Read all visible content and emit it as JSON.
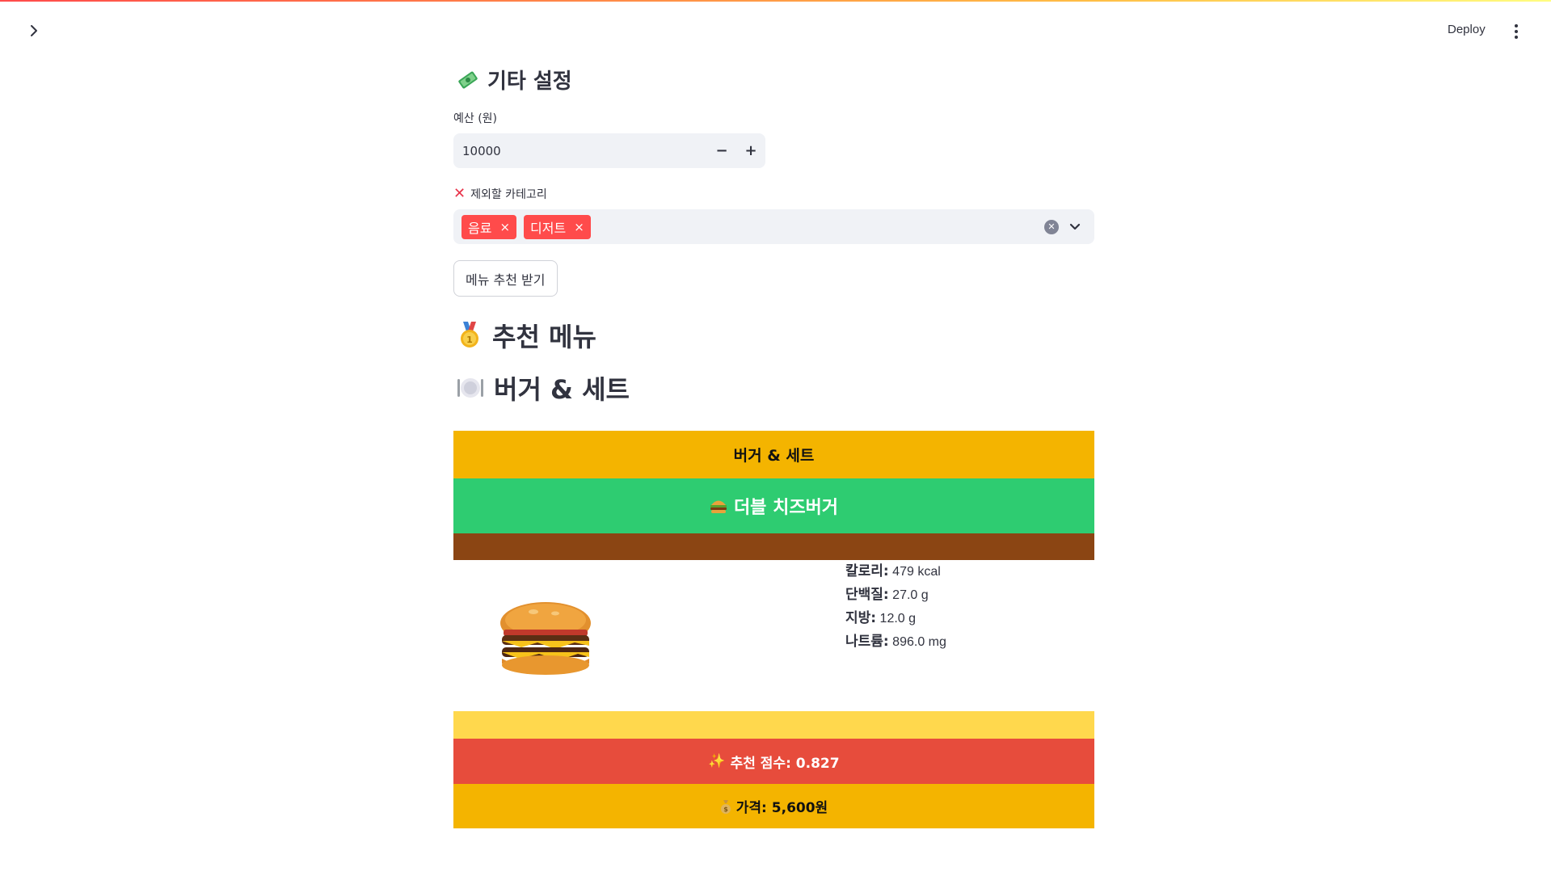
{
  "header": {
    "deploy_label": "Deploy",
    "sidebar_toggle_icon": "chevron-right-icon",
    "menu_icon": "kebab-menu-icon",
    "accent_gradient": [
      "#ff4b4b",
      "#ffbd45",
      "#fffd80"
    ]
  },
  "settings": {
    "icon": "money-with-wings-icon",
    "title": "기타 설정",
    "budget_label": "예산 (원)",
    "budget_value": "10000",
    "minus_label": "−",
    "plus_label": "+",
    "exclude_icon": "cross-mark-icon",
    "exclude_label": "제외할 카테고리",
    "excluded_tags": [
      "음료",
      "디저트"
    ],
    "tag_remove_label": "×",
    "recommend_button": "메뉴 추천 받기"
  },
  "results": {
    "heading_icon": "first-place-medal-icon",
    "heading": "추천 메뉴",
    "category_icon": "plate-with-cutlery-icon",
    "category_heading": "버거 & 세트"
  },
  "card": {
    "category": "버거 & 세트",
    "name_icon": "hamburger-icon",
    "name": "더블 치즈버거",
    "image": "double-cheeseburger-image",
    "nutrition": {
      "calories_label": "칼로리:",
      "calories_value": "479 kcal",
      "protein_label": "단백질:",
      "protein_value": "27.0 g",
      "fat_label": "지방:",
      "fat_value": "12.0 g",
      "sodium_label": "나트륨:",
      "sodium_value": "896.0 mg"
    },
    "score_icon": "sparkles-icon",
    "score_text": "추천 점수: 0.827",
    "price_icon": "money-bag-icon",
    "price_text": "가격: 5,600원",
    "colors": {
      "category_band": "#f4b400",
      "name_band": "#2ecc71",
      "brown_band": "#8b4513",
      "yellow_band": "#ffd84d",
      "score_band": "#e74c3c",
      "price_band": "#f4b400"
    }
  }
}
